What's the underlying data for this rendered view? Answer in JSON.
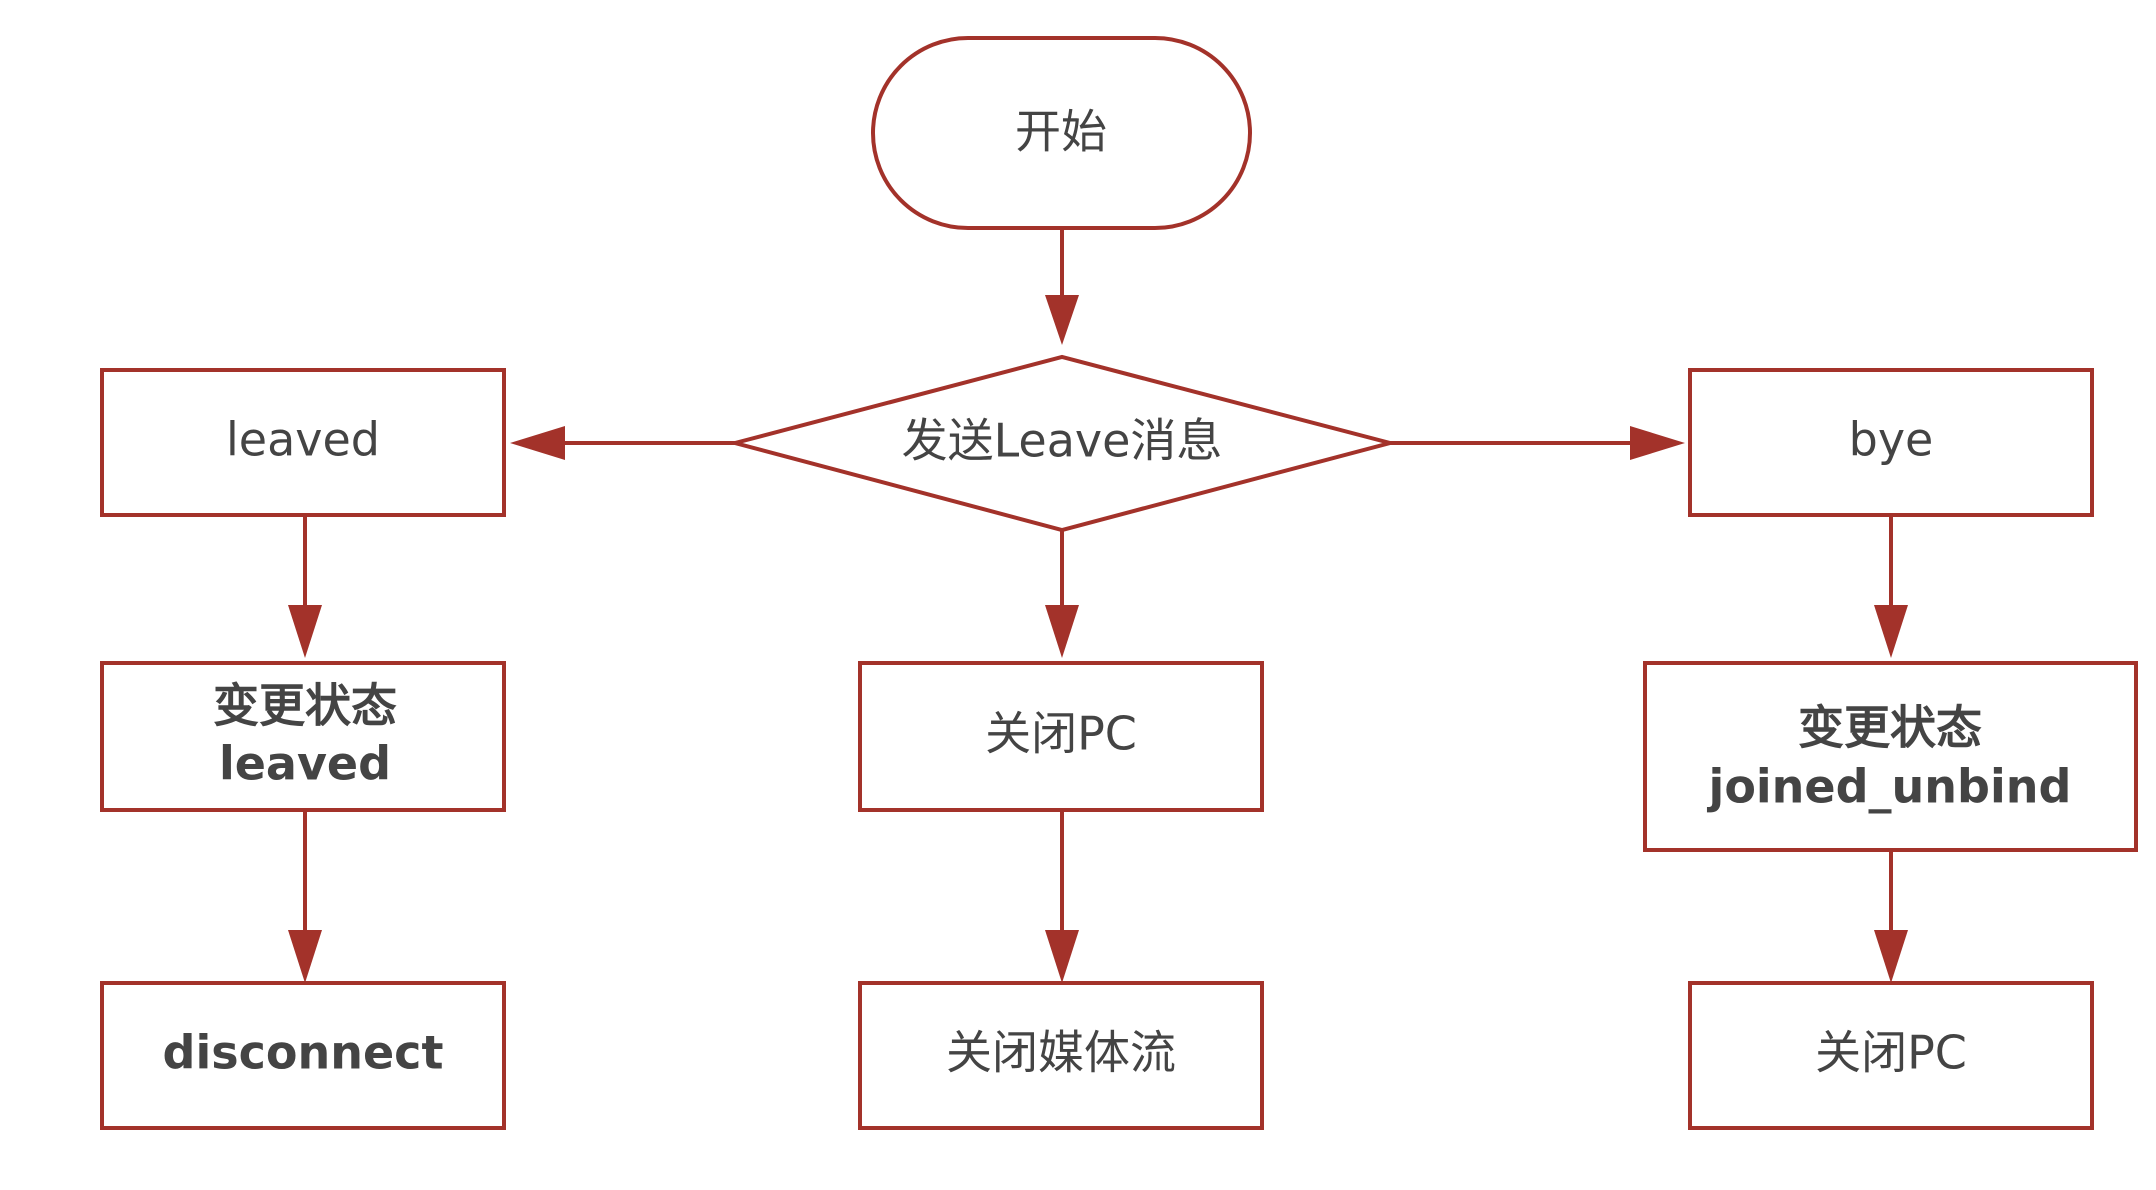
{
  "diagram": {
    "type": "flowchart",
    "colors": {
      "stroke": "#a3322a",
      "fill": "#ffffff",
      "text": "#444444"
    },
    "nodes": {
      "start": {
        "shape": "terminator",
        "label": "开始"
      },
      "decision": {
        "shape": "decision",
        "label": "发送Leave消息"
      },
      "leaved": {
        "shape": "process",
        "label": "leaved"
      },
      "change_leaved": {
        "shape": "process",
        "line1": "变更状态",
        "line2": "leaved"
      },
      "disconnect": {
        "shape": "process",
        "label": "disconnect"
      },
      "close_pc_center": {
        "shape": "process",
        "label": "关闭PC"
      },
      "close_stream": {
        "shape": "process",
        "label": "关闭媒体流"
      },
      "bye": {
        "shape": "process",
        "label": "bye"
      },
      "change_unbind": {
        "shape": "process",
        "line1": "变更状态",
        "line2": "joined_unbind"
      },
      "close_pc_right": {
        "shape": "process",
        "label": "关闭PC"
      }
    },
    "edges": [
      {
        "from": "start",
        "to": "decision"
      },
      {
        "from": "decision",
        "to": "leaved"
      },
      {
        "from": "decision",
        "to": "bye"
      },
      {
        "from": "decision",
        "to": "close_pc_center"
      },
      {
        "from": "leaved",
        "to": "change_leaved"
      },
      {
        "from": "change_leaved",
        "to": "disconnect"
      },
      {
        "from": "close_pc_center",
        "to": "close_stream"
      },
      {
        "from": "bye",
        "to": "change_unbind"
      },
      {
        "from": "change_unbind",
        "to": "close_pc_right"
      }
    ]
  }
}
